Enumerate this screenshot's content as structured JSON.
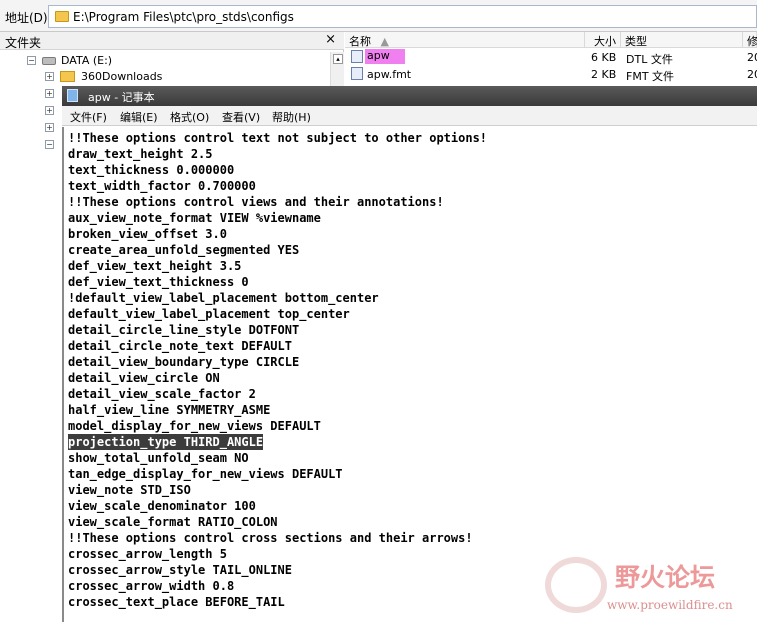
{
  "address_bar": {
    "label": "地址(D)",
    "path": "E:\\Program Files\\ptc\\pro_stds\\configs"
  },
  "folder_pane": {
    "title": "文件夹",
    "close_glyph": "×",
    "tree": [
      {
        "label": "DATA (E:)",
        "toggle": "−"
      },
      {
        "label": "360Downloads",
        "toggle": "+"
      }
    ]
  },
  "file_list": {
    "columns": [
      "名称",
      "大小",
      "类型",
      "修"
    ],
    "rows": [
      {
        "name": "apw",
        "size": "6 KB",
        "type": "DTL 文件",
        "date": "20"
      },
      {
        "name": "apw.fmt",
        "size": "2 KB",
        "type": "FMT 文件",
        "date": "20"
      }
    ]
  },
  "notepad": {
    "title": "apw - 记事本",
    "menu": [
      "文件(F)",
      "编辑(E)",
      "格式(O)",
      "查看(V)",
      "帮助(H)"
    ],
    "lines": [
      "!!These options control text not subject to other options!",
      "draw_text_height 2.5",
      "text_thickness 0.000000",
      "text_width_factor 0.700000",
      "!!These options control views and their annotations!",
      "aux_view_note_format VIEW %viewname",
      "broken_view_offset 3.0",
      "create_area_unfold_segmented YES",
      "def_view_text_height 3.5",
      "def_view_text_thickness 0",
      "!default_view_label_placement bottom_center",
      "default_view_label_placement top_center",
      "detail_circle_line_style DOTFONT",
      "detail_circle_note_text DEFAULT",
      "detail_view_boundary_type CIRCLE",
      "detail_view_circle ON",
      "detail_view_scale_factor 2",
      "half_view_line SYMMETRY_ASME",
      "model_display_for_new_views DEFAULT",
      "projection_type THIRD_ANGLE",
      "show_total_unfold_seam NO",
      "tan_edge_display_for_new_views DEFAULT",
      "view_note STD_ISO",
      "view_scale_denominator 100",
      "view_scale_format RATIO_COLON",
      "!!These options control cross sections and their arrows!",
      "crossec_arrow_length 5",
      "crossec_arrow_style TAIL_ONLINE",
      "crossec_arrow_width 0.8",
      "crossec_text_place BEFORE_TAIL"
    ],
    "selected_line_index": 19
  },
  "watermark": {
    "site_name": "野火论坛",
    "url": "www.proewildfire.cn"
  }
}
